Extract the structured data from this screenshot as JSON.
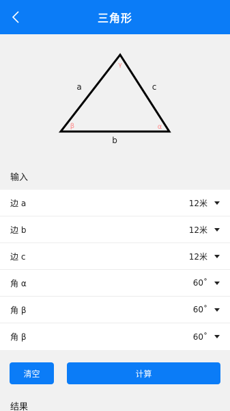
{
  "header": {
    "title": "三角形",
    "back_icon": "chevron-left-icon"
  },
  "diagram": {
    "side_a": "a",
    "side_b": "b",
    "side_c": "c",
    "angle_top": "γ",
    "angle_left": "β",
    "angle_right": "α",
    "line_color": "#000000",
    "angle_color": "#ff8a8a"
  },
  "input_section": {
    "title": "输入"
  },
  "rows": [
    {
      "label": "边 a",
      "value": "12米"
    },
    {
      "label": "边 b",
      "value": "12米"
    },
    {
      "label": "边 c",
      "value": "12米"
    },
    {
      "label": "角 α",
      "value": "60˚"
    },
    {
      "label": "角 β",
      "value": "60˚"
    },
    {
      "label": "角 β",
      "value": "60˚"
    }
  ],
  "buttons": {
    "clear": "清空",
    "calculate": "计算"
  },
  "result_section": {
    "title": "结果"
  },
  "colors": {
    "primary": "#0b7cf7",
    "background": "#f1f1f1"
  }
}
